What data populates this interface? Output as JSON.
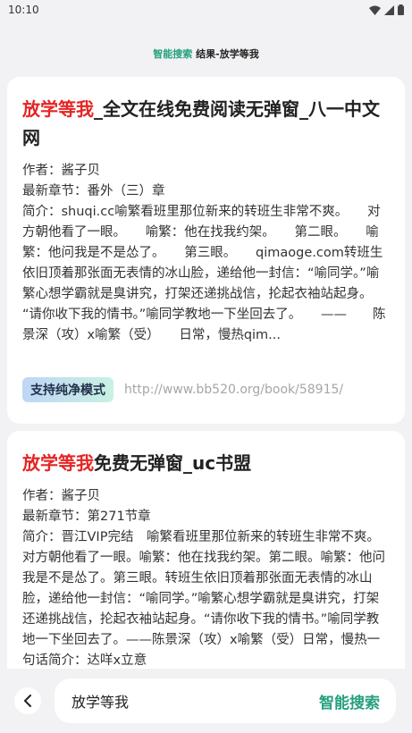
{
  "status_bar": {
    "time": "10:10"
  },
  "header": {
    "prefix": "智能搜索",
    "title": "结果-放学等我"
  },
  "results": [
    {
      "title_highlight": "放学等我",
      "title_rest": "_全文在线免费阅读无弹窗_八一中文网",
      "author": "作者：酱子贝",
      "latest_chapter": "最新章节：番外（三）章",
      "intro": "简介：shuqi.cc喻繁看班里那位新来的转班生非常不爽。　　对方朝他看了一眼。　　喻繁：他在找我约架。　　第二眼。　　喻繁：他问我是不是怂了。　　第三眼。　　qimaoge.com转班生依旧顶着那张面无表情的冰山脸，递给他一封信：“喻同学。”喻繁心想学霸就是臭讲究，打架还递挑战信，抡起衣袖站起身。　　“请你收下我的情书。”喻同学教地一下坐回去了。　　——　　陈景深（攻）x喻繁（受）　　日常，慢热qim...",
      "badge": "支持纯净模式",
      "url": "http://www.bb520.org/book/58915/"
    },
    {
      "title_highlight": "放学等我",
      "title_rest": "免费无弹窗_uc书盟",
      "author": "作者：酱子贝",
      "latest_chapter": "最新章节：第271节章",
      "intro": "简介：晋江VIP完结　喻繁看班里那位新来的转班生非常不爽。对方朝他看了一眼。喻繁：他在找我约架。第二眼。喻繁：他问我是不是怂了。第三眼。转班生依旧顶着那张面无表情的冰山脸，递给他一封信：“喻同学。”喻繁心想学霸就是臭讲究，打架还递挑战信，抡起衣袖站起身。“请你收下我的情书。”喻同学教地一下坐回去了。——陈景深（攻）x喻繁（受）日常，慢热一句话简介：达咩x立意"
    }
  ],
  "search_bar": {
    "query": "放学等我",
    "button": "智能搜索"
  },
  "colors": {
    "accent": "#25a07e",
    "highlight": "#e62424"
  }
}
